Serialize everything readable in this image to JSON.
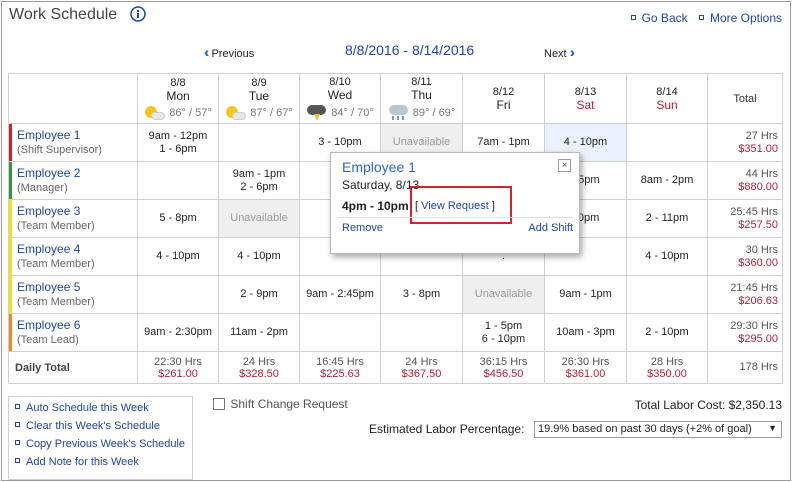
{
  "title": "Work Schedule",
  "links": {
    "go_back": "Go Back",
    "more_options": "More Options"
  },
  "nav": {
    "prev": "Previous",
    "next": "Next",
    "range": "8/8/2016 - 8/14/2016"
  },
  "total_header": "Total",
  "days": [
    {
      "date": "8/8",
      "name": "Mon",
      "weather_icon": "partly-sunny-icon",
      "temps": "86° / 57°"
    },
    {
      "date": "8/9",
      "name": "Tue",
      "weather_icon": "partly-sunny-icon",
      "temps": "87° / 67°"
    },
    {
      "date": "8/10",
      "name": "Wed",
      "weather_icon": "thunderstorm-icon",
      "temps": "84° / 70°"
    },
    {
      "date": "8/11",
      "name": "Thu",
      "weather_icon": "rain-icon",
      "temps": "89° / 69°"
    },
    {
      "date": "8/12",
      "name": "Fri"
    },
    {
      "date": "8/13",
      "name": "Sat"
    },
    {
      "date": "8/14",
      "name": "Sun"
    }
  ],
  "employees": [
    {
      "name": "Employee 1",
      "role": "(Shift Supervisor)",
      "color": "#d0202e",
      "shifts": [
        [
          "9am - 12pm",
          "1 - 6pm"
        ],
        [],
        [
          "3 - 10pm"
        ],
        [
          "Unavailable"
        ],
        [
          "7am - 1pm"
        ],
        [
          "4 - 10pm"
        ],
        []
      ],
      "hours": "27 Hrs",
      "cost": "$351.00"
    },
    {
      "name": "Employee 2",
      "role": "(Manager)",
      "color": "#2e9b3d",
      "shifts": [
        [],
        [
          "9am - 1pm",
          "2 - 6pm"
        ],
        [
          "9a"
        ],
        [],
        [],
        [
          "- 5pm"
        ],
        [
          "8am - 2pm"
        ]
      ],
      "hours": "44 Hrs",
      "cost": "$880.00"
    },
    {
      "name": "Employee 3",
      "role": "(Team Member)",
      "color": "#f2e219",
      "shifts": [
        [
          "5 - 8pm"
        ],
        [
          "Unavailable"
        ],
        [],
        [],
        [],
        [
          "10pm"
        ],
        [
          "2 - 11pm"
        ]
      ],
      "hours": "25:45 Hrs",
      "cost": "$257.50"
    },
    {
      "name": "Employee 4",
      "role": "(Team Member)",
      "color": "#f2e219",
      "shifts": [
        [
          "4 - 10pm"
        ],
        [
          "4 - 10pm"
        ],
        [],
        [],
        [
          "."
        ],
        [],
        [
          "4 - 10pm"
        ]
      ],
      "hours": "30 Hrs",
      "cost": "$360.00"
    },
    {
      "name": "Employee 5",
      "role": "(Team Member)",
      "color": "#f2e219",
      "shifts": [
        [],
        [
          "2 - 9pm"
        ],
        [
          "9am - 2:45pm"
        ],
        [
          "3 - 8pm"
        ],
        [
          "Unavailable"
        ],
        [
          "9am - 1pm"
        ],
        []
      ],
      "hours": "21:45 Hrs",
      "cost": "$206.63"
    },
    {
      "name": "Employee 6",
      "role": "(Team Lead)",
      "color": "#f08a24",
      "shifts": [
        [
          "9am - 2:30pm"
        ],
        [
          "11am - 2pm"
        ],
        [],
        [],
        [
          "1 - 5pm",
          "6 - 10pm"
        ],
        [
          "10am - 3pm"
        ],
        [
          "2 - 10pm"
        ]
      ],
      "hours": "29:30 Hrs",
      "cost": "$295.00"
    }
  ],
  "daily_total": {
    "label": "Daily Total",
    "days": [
      {
        "hours": "22:30 Hrs",
        "cost": "$261.00"
      },
      {
        "hours": "24 Hrs",
        "cost": "$328.50"
      },
      {
        "hours": "16:45 Hrs",
        "cost": "$225.63"
      },
      {
        "hours": "24 Hrs",
        "cost": "$367.50"
      },
      {
        "hours": "36:15 Hrs",
        "cost": "$456.50"
      },
      {
        "hours": "26:30 Hrs",
        "cost": "$361.00"
      },
      {
        "hours": "28 Hrs",
        "cost": "$350.00"
      }
    ],
    "total": "178 Hrs"
  },
  "popup": {
    "employee": "Employee 1",
    "date": "Saturday, 8/13",
    "time": "4pm - 10pm",
    "view_request_open": "[",
    "view_request": "View Request",
    "view_request_close": "]",
    "remove": "Remove",
    "add_shift": "Add Shift",
    "close": "×"
  },
  "actions": [
    "Auto Schedule this Week",
    "Clear this Week's Schedule",
    "Copy Previous Week's Schedule",
    "Add Note for this Week"
  ],
  "shift_change_request": "Shift Change Request",
  "total_labor_cost": "Total Labor Cost: $2,350.13",
  "estimated_labor_label": "Estimated Labor Percentage:",
  "estimated_labor_value": "19.9% based on past 30 days (+2% of goal)"
}
